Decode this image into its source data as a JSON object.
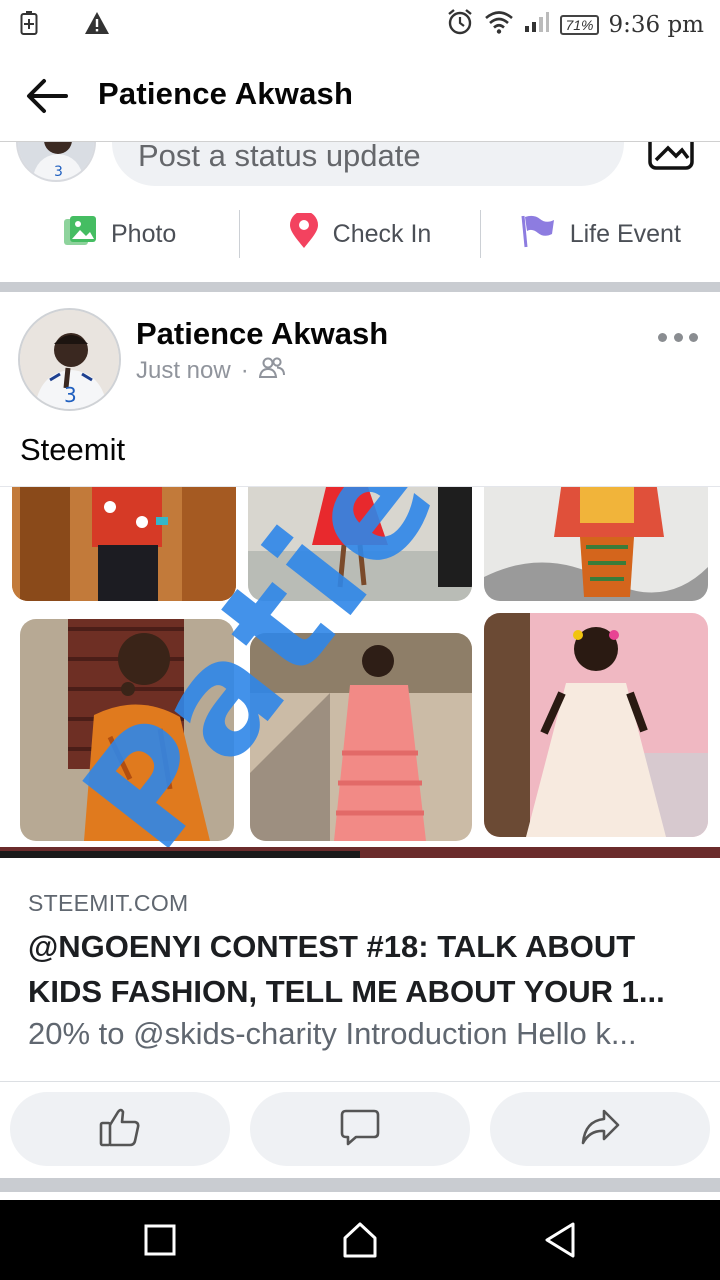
{
  "status_bar": {
    "battery_percent": "71%",
    "time": "9:36 pm",
    "icons": [
      "battery-charging-icon",
      "warning-icon",
      "alarm-icon",
      "wifi-icon",
      "signal-icon"
    ]
  },
  "header": {
    "title": "Patience Akwash",
    "back_icon": "arrow-left-icon"
  },
  "composer": {
    "placeholder": "Post a status update",
    "actions": [
      {
        "label": "Photo",
        "icon": "photo-icon",
        "color": "#45bd62"
      },
      {
        "label": "Check In",
        "icon": "location-pin-icon",
        "color": "#f3425f"
      },
      {
        "label": "Life Event",
        "icon": "flag-icon",
        "color": "#8d7ce0"
      }
    ]
  },
  "post": {
    "author": "Patience Akwash",
    "time": "Just now",
    "separator": "·",
    "audience_icon": "friends-icon",
    "text": "Steemit",
    "link": {
      "domain": "STEEMIT.COM",
      "title": "@NGOENYI CONTEST #18: TALK ABOUT KIDS FASHION, TELL ME ABOUT YOUR 1...",
      "description": "20% to @skids-charity Introduction Hello k..."
    },
    "actions": [
      {
        "name": "like",
        "icon": "thumbs-up-icon"
      },
      {
        "name": "comment",
        "icon": "comment-icon"
      },
      {
        "name": "share",
        "icon": "share-icon"
      }
    ]
  },
  "colors": {
    "accent_blue": "#1877f2",
    "watermark_blue": "#3d8ee0",
    "text_secondary": "#65676b",
    "divider": "#c9ccd1"
  },
  "nav_bar": {
    "buttons": [
      "recents-button",
      "home-button",
      "back-button"
    ]
  }
}
